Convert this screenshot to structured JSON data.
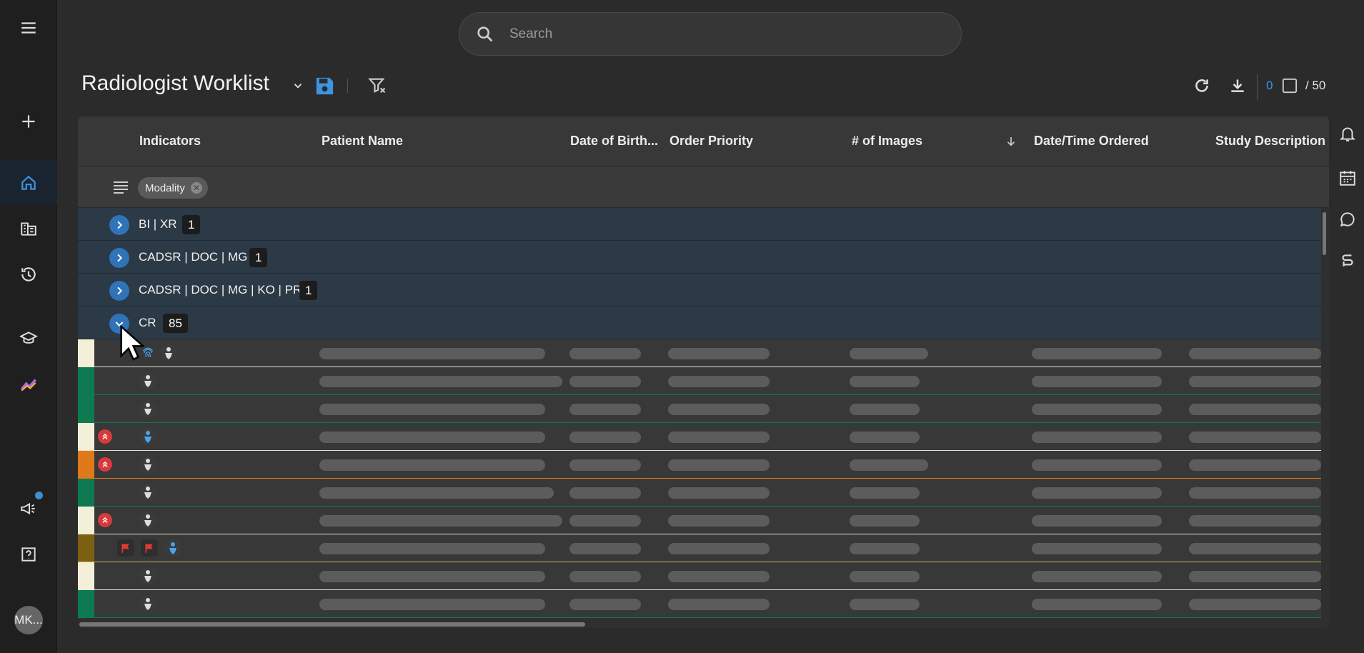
{
  "search": {
    "placeholder": "Search"
  },
  "header": {
    "title": "Radiologist Worklist",
    "selected_count": "0",
    "total_label": "/ 50"
  },
  "columns": [
    "Indicators",
    "Patient Name",
    "Date of Birth...",
    "Order Priority",
    "# of Images",
    "Date/Time Ordered",
    "Study Description"
  ],
  "group_by_chip": "Modality",
  "groups": [
    {
      "label": "BI | XR",
      "count": "1",
      "expanded": false
    },
    {
      "label": "CADSR | DOC | MG",
      "count": "1",
      "expanded": false
    },
    {
      "label": "CADSR | DOC | MG | KO | PR",
      "count": "1",
      "expanded": false
    },
    {
      "label": "CR",
      "count": "85",
      "expanded": true
    }
  ],
  "user": {
    "initials": "MK..."
  },
  "colors": {
    "accent": "#3d95e0",
    "status_cream": "#f3efd8",
    "status_green": "#0f7a52",
    "status_orange": "#e0791a",
    "status_olive": "#7a6010",
    "escalation": "#d73a3a",
    "flag": "#e53935"
  },
  "rows": [
    {
      "status": "cream",
      "indicators": [
        "fingerprint-icon",
        "user-icon"
      ]
    },
    {
      "status": "green",
      "indicators": [
        "user-icon"
      ]
    },
    {
      "status": "green",
      "indicators": [
        "user-icon"
      ]
    },
    {
      "status": "cream",
      "indicators": [
        "escalation-icon",
        "user-blue-icon"
      ]
    },
    {
      "status": "orange",
      "indicators": [
        "escalation-icon",
        "user-icon"
      ]
    },
    {
      "status": "green",
      "indicators": [
        "user-icon"
      ]
    },
    {
      "status": "cream",
      "indicators": [
        "escalation-icon",
        "user-icon"
      ]
    },
    {
      "status": "olive",
      "indicators": [
        "flag-icon",
        "flag-icon",
        "user-blue-icon"
      ]
    },
    {
      "status": "cream",
      "indicators": [
        "user-icon"
      ]
    },
    {
      "status": "green",
      "indicators": [
        "user-icon"
      ]
    }
  ]
}
